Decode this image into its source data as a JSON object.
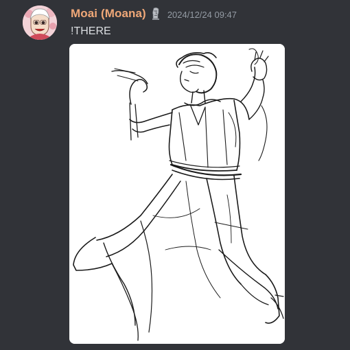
{
  "message": {
    "author": {
      "name": "Moai (Moana)",
      "name_color": "#f0a878",
      "avatar_icon": "avatar-icon",
      "role_icon": "moai-statue-icon"
    },
    "timestamp": "2024/12/24 09:47",
    "content": "!THERE",
    "attachment": {
      "type": "image",
      "description_icon": "sketch-drawing-image"
    }
  },
  "colors": {
    "background": "#313338",
    "text": "#dbdee1",
    "timestamp": "#949ba4"
  }
}
